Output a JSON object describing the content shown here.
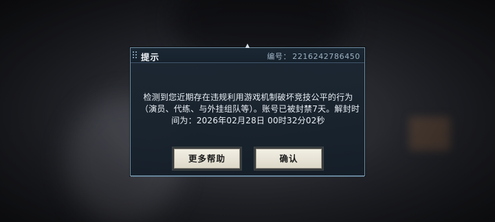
{
  "dialog": {
    "title": "提示",
    "ticket_label": "编号：",
    "ticket_number": "2216242786450",
    "message_lines": [
      "检测到您近期存在违规利用游戏机制破坏竞技公平的行为",
      "（演员、代练、与外挂组队等）。账号已被封禁7天。解封时",
      "间为：2026年02月28日 00时32分02秒"
    ],
    "buttons": {
      "help_label": "更多帮助",
      "confirm_label": "确认"
    }
  },
  "colors": {
    "dialog_border": "#6f8ea4",
    "dialog_bg": "#1c2834",
    "button_bg": "#eeeadd",
    "text": "#e9eef3"
  },
  "icons": {
    "top_notch": "arrow-up-icon",
    "grip": "drag-grip-icon"
  }
}
